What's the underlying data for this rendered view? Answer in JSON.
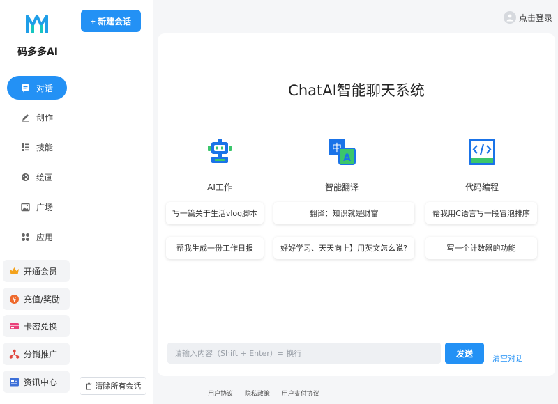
{
  "brand": {
    "name": "码多多AI"
  },
  "nav": {
    "items": [
      {
        "label": "对话",
        "icon": "chat-icon"
      },
      {
        "label": "创作",
        "icon": "pen-icon"
      },
      {
        "label": "技能",
        "icon": "skills-icon"
      },
      {
        "label": "绘画",
        "icon": "palette-icon"
      },
      {
        "label": "广场",
        "icon": "image-icon"
      },
      {
        "label": "应用",
        "icon": "apps-icon"
      }
    ],
    "promos": [
      {
        "label": "开通会员",
        "icon": "crown-icon"
      },
      {
        "label": "充值/奖励",
        "icon": "coin-icon"
      },
      {
        "label": "卡密兑换",
        "icon": "card-icon"
      },
      {
        "label": "分销推广",
        "icon": "share-icon"
      },
      {
        "label": "资讯中心",
        "icon": "news-icon"
      }
    ]
  },
  "conversations": {
    "new_label": "+ 新建会话",
    "clear_all_label": "清除所有会话"
  },
  "header": {
    "login_label": "点击登录"
  },
  "main": {
    "title": "ChatAI智能聊天系统",
    "features": [
      {
        "label": "AI工作",
        "icon": "robot-icon"
      },
      {
        "label": "智能翻译",
        "icon": "translate-icon"
      },
      {
        "label": "代码编程",
        "icon": "code-icon"
      }
    ],
    "prompts_row1": [
      "写一篇关于生活vlog脚本",
      "翻译：知识就是财富",
      "帮我用C语言写一段冒泡排序"
    ],
    "prompts_row2": [
      "帮我生成一份工作日报",
      "好好学习、天天向上】用英文怎么说?",
      "写一个计数器的功能"
    ],
    "input": {
      "placeholder": "请输入内容（Shift + Enter）= 换行"
    },
    "send_label": "发送",
    "clear_chat_label": "清空对话"
  },
  "footer": {
    "links": [
      "用户协议",
      "隐私政策",
      "用户支付协议"
    ],
    "separator": "|"
  },
  "colors": {
    "accent": "#2391f5",
    "icon_green": "#3bc66b",
    "icon_blue": "#1a73e8"
  }
}
